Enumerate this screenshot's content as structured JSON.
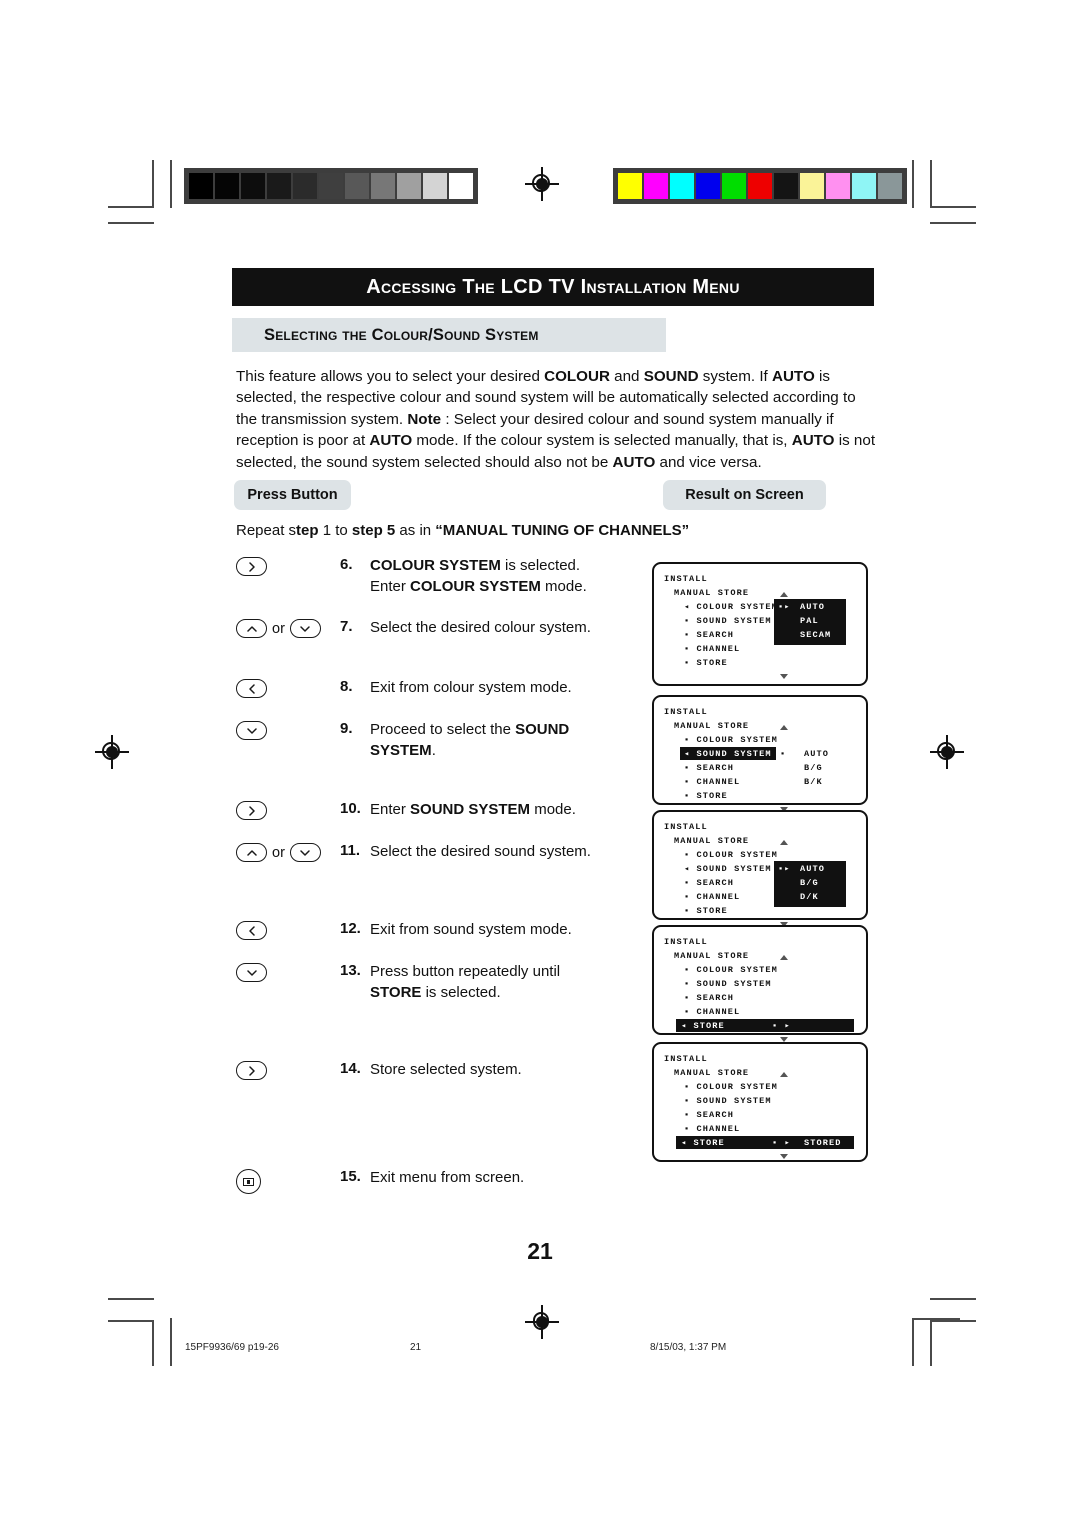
{
  "document": {
    "title": "Accessing the LCD TV Installation Menu",
    "subtitle": "Selecting the Colour/Sound System",
    "page_number": "21"
  },
  "intro": {
    "l1a": "This feature allows you to select your desired ",
    "l1b": "COLOUR",
    "l1c": " and ",
    "l1d": "SOUND",
    "l1e": " system. If ",
    "l1f": "AUTO",
    "l2": "is selected, the respective colour and sound system will be automatically selected according",
    "l3a": "to the transmission system. ",
    "l3b": "Note",
    "l3c": " : Select your desired colour and sound system manually if",
    "l4a": "reception is poor at ",
    "l4b": "AUTO",
    "l4c": " mode. If the colour system is selected manually, that is, ",
    "l4d": "AUTO",
    "l5a": "is not selected,  the sound system selected should also not be ",
    "l5b": "AUTO",
    "l5c": " and vice versa."
  },
  "table_headers": {
    "press_button": "Press Button",
    "result_on_screen": "Result on Screen"
  },
  "repeat_line": {
    "a": "Repeat s",
    "b": "tep",
    "c": " 1 to ",
    "d": "step 5",
    "e": " as in ",
    "f": "“MANUAL TUNING OF CHANNELS”"
  },
  "steps": [
    {
      "num": "6.",
      "buttons": [
        "right"
      ],
      "text_parts": [
        {
          "t": "COLOUR SYSTEM",
          "b": true
        },
        {
          "t": " is selected.",
          "b": false
        },
        {
          "t": "\n",
          "b": false
        },
        {
          "t": "Enter ",
          "b": false
        },
        {
          "t": "COLOUR SYSTEM",
          "b": true
        },
        {
          "t": " mode.",
          "b": false
        }
      ]
    },
    {
      "num": "7.",
      "buttons": [
        "up",
        "or",
        "down"
      ],
      "text_parts": [
        {
          "t": "Select the desired colour system.",
          "b": false
        }
      ]
    },
    {
      "num": "8.",
      "buttons": [
        "left"
      ],
      "text_parts": [
        {
          "t": "Exit from colour system mode.",
          "b": false
        }
      ]
    },
    {
      "num": "9.",
      "buttons": [
        "down"
      ],
      "text_parts": [
        {
          "t": "Proceed to select the ",
          "b": false
        },
        {
          "t": "SOUND",
          "b": true
        },
        {
          "t": "\n",
          "b": false
        },
        {
          "t": "SYSTEM",
          "b": true
        },
        {
          "t": ".",
          "b": false
        }
      ]
    },
    {
      "num": "10.",
      "buttons": [
        "right"
      ],
      "text_parts": [
        {
          "t": "Enter ",
          "b": false
        },
        {
          "t": "SOUND SYSTEM",
          "b": true
        },
        {
          "t": " mode.",
          "b": false
        }
      ]
    },
    {
      "num": "11.",
      "buttons": [
        "up",
        "or",
        "down"
      ],
      "text_parts": [
        {
          "t": "Select the desired sound system.",
          "b": false
        }
      ]
    },
    {
      "num": "12.",
      "buttons": [
        "left"
      ],
      "text_parts": [
        {
          "t": "Exit from sound system mode.",
          "b": false
        }
      ]
    },
    {
      "num": "13.",
      "buttons": [
        "down"
      ],
      "text_parts": [
        {
          "t": "Press button repeatedly until",
          "b": false
        },
        {
          "t": "\n",
          "b": false
        },
        {
          "t": "STORE",
          "b": true
        },
        {
          "t": " is selected.",
          "b": false
        }
      ]
    },
    {
      "num": "14.",
      "buttons": [
        "right"
      ],
      "text_parts": [
        {
          "t": "Store selected system.",
          "b": false
        }
      ]
    },
    {
      "num": "15.",
      "buttons": [
        "menu"
      ],
      "text_parts": [
        {
          "t": "Exit menu from screen.",
          "b": false
        }
      ]
    }
  ],
  "osd_panels": [
    {
      "id": "panel-1",
      "header1": "INSTALL",
      "header2": "MANUAL STORE",
      "items": [
        "COLOUR SYSTEM",
        "SOUND SYSTEM",
        "SEARCH",
        "CHANNEL",
        "STORE"
      ],
      "cursor_item_index": 0,
      "highlight_item_index": null,
      "value_box": {
        "style": "inverted",
        "marker": "▪▸",
        "values": [
          "AUTO",
          "PAL",
          "SECAM"
        ]
      },
      "scroll_up": true,
      "scroll_down": true
    },
    {
      "id": "panel-2",
      "header1": "INSTALL",
      "header2": "MANUAL STORE",
      "items": [
        "COLOUR SYSTEM",
        "SOUND SYSTEM",
        "SEARCH",
        "CHANNEL",
        "STORE"
      ],
      "cursor_item_index": 1,
      "highlight_item_index": 1,
      "value_box": {
        "style": "plain",
        "marker": "▪",
        "values": [
          "AUTO",
          "B/G",
          "B/K"
        ]
      },
      "scroll_up": true,
      "scroll_down": true
    },
    {
      "id": "panel-3",
      "header1": "INSTALL",
      "header2": "MANUAL STORE",
      "items": [
        "COLOUR SYSTEM",
        "SOUND SYSTEM",
        "SEARCH",
        "CHANNEL",
        "STORE"
      ],
      "cursor_item_index": 1,
      "highlight_item_index": null,
      "value_box": {
        "style": "inverted",
        "marker": "▪▸",
        "values": [
          "AUTO",
          "B/G",
          "D/K"
        ]
      },
      "scroll_up": true,
      "scroll_down": true
    },
    {
      "id": "panel-4",
      "header1": "INSTALL",
      "header2": "MANUAL STORE",
      "items": [
        "COLOUR SYSTEM",
        "SOUND SYSTEM",
        "SEARCH",
        "CHANNEL",
        "STORE"
      ],
      "cursor_item_index": 4,
      "highlight_item_index": 4,
      "store_bar": {
        "marker": "▪ ▸",
        "result": ""
      },
      "scroll_up": true,
      "scroll_down": true
    },
    {
      "id": "panel-5",
      "header1": "INSTALL",
      "header2": "MANUAL STORE",
      "items": [
        "COLOUR SYSTEM",
        "SOUND SYSTEM",
        "SEARCH",
        "CHANNEL",
        "STORE"
      ],
      "cursor_item_index": 4,
      "highlight_item_index": 4,
      "store_bar": {
        "marker": "▪ ▸",
        "result": "STORED"
      },
      "scroll_up": true,
      "scroll_down": true
    }
  ],
  "calibration": {
    "grayscale_patches": [
      "#000000",
      "#050505",
      "#0d0d0d",
      "#1a1a1a",
      "#2b2b2b",
      "#3f3f3f",
      "#585858",
      "#777777",
      "#a0a0a0",
      "#d4d4d4",
      "#ffffff"
    ],
    "colour_patches": [
      "#ffff00",
      "#ff00ff",
      "#00ffff",
      "#0000ee",
      "#00dd00",
      "#ee0000",
      "#141414",
      "#faf398",
      "#ff90f0",
      "#8ff5f5",
      "#8a9799"
    ]
  },
  "footer": {
    "job": "15PF9936/69 p19-26",
    "page": "21",
    "timestamp": "8/15/03, 1:37 PM"
  }
}
